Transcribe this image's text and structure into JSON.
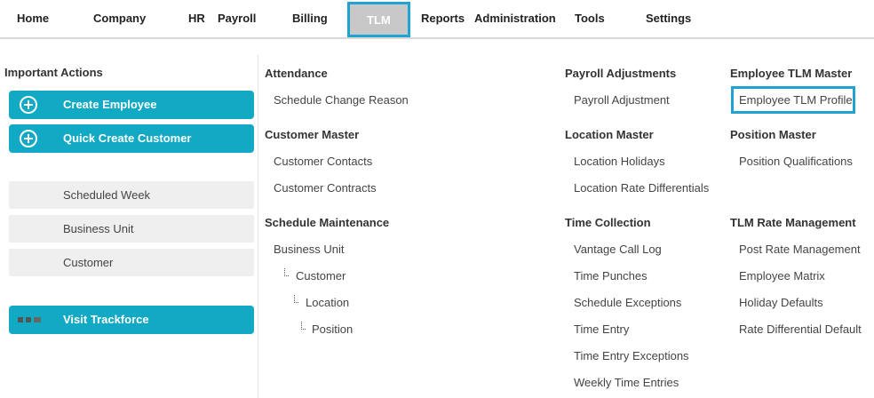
{
  "nav": {
    "home": "Home",
    "company": "Company",
    "hr": "HR",
    "payroll": "Payroll",
    "billing": "Billing",
    "tlm": "TLM",
    "reports": "Reports",
    "administration": "Administration",
    "tools": "Tools",
    "settings": "Settings"
  },
  "left": {
    "title": "Important Actions",
    "create_employee": "Create Employee",
    "quick_create_customer": "Quick Create Customer",
    "scheduled_week": "Scheduled Week",
    "business_unit": "Business Unit",
    "customer": "Customer",
    "visit_trackforce": "Visit Trackforce"
  },
  "col1": {
    "attendance": {
      "title": "Attendance",
      "schedule_change_reason": "Schedule Change Reason"
    },
    "customer_master": {
      "title": "Customer Master",
      "customer_contacts": "Customer Contacts",
      "customer_contracts": "Customer Contracts"
    },
    "schedule_maintenance": {
      "title": "Schedule Maintenance",
      "business_unit": "Business Unit",
      "customer": "Customer",
      "location": "Location",
      "position": "Position"
    }
  },
  "col2": {
    "payroll_adjustments": {
      "title": "Payroll Adjustments",
      "payroll_adjustment": "Payroll Adjustment"
    },
    "location_master": {
      "title": "Location Master",
      "location_holidays": "Location Holidays",
      "location_rate_differentials": "Location Rate Differentials"
    },
    "time_collection": {
      "title": "Time Collection",
      "vantage_call_log": "Vantage Call Log",
      "time_punches": "Time Punches",
      "schedule_exceptions": "Schedule Exceptions",
      "time_entry": "Time Entry",
      "time_entry_exceptions": "Time Entry Exceptions",
      "weekly_time_entries": "Weekly Time Entries"
    }
  },
  "col3": {
    "employee_tlm_master": {
      "title": "Employee TLM Master",
      "employee_tlm_profile": "Employee TLM Profile"
    },
    "position_master": {
      "title": "Position Master",
      "position_qualifications": "Position Qualifications"
    },
    "tlm_rate_management": {
      "title": "TLM Rate Management",
      "post_rate_management": "Post Rate Management",
      "employee_matrix": "Employee Matrix",
      "holiday_defaults": "Holiday Defaults",
      "rate_differential_default": "Rate Differential Default"
    }
  },
  "colors": {
    "accent": "#12a9c5",
    "highlight": "#1fa3d1",
    "active_tab_bg": "#c8c8c8",
    "grey_button_bg": "#efefef",
    "trackforce_icon": [
      "#555555",
      "#555555",
      "#666666"
    ]
  },
  "icons": {
    "create_employee": "plus-circle-icon",
    "quick_create_customer": "plus-circle-icon",
    "visit_trackforce": "trackforce-logo-icon",
    "tree_connector": "tree-branch-icon"
  }
}
